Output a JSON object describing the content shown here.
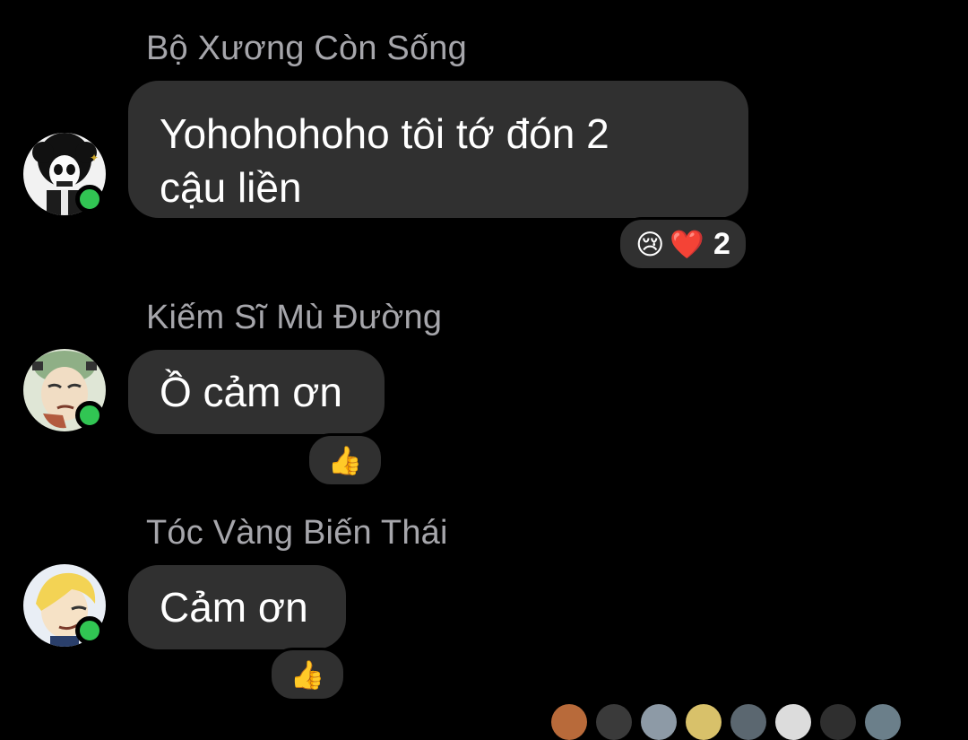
{
  "messages": [
    {
      "sender": "Bộ Xương Còn Sống",
      "text_line1": "Yohohohoho tôi tớ đón 2",
      "text_line2": "cậu liền",
      "reactions": [
        "😢",
        "❤️"
      ],
      "reaction_count": "2",
      "avatar": "brook-skeleton-avatar",
      "online": true
    },
    {
      "sender": "Kiếm Sĩ Mù Đường",
      "text_line1": "Ồ cảm ơn",
      "reactions": [
        "👍"
      ],
      "avatar": "zoro-swordsman-avatar",
      "online": true
    },
    {
      "sender": "Tóc Vàng Biến Thái",
      "text_line1": "Cảm ơn",
      "reactions": [
        "👍"
      ],
      "avatar": "sanji-blonde-avatar",
      "online": true
    }
  ],
  "colors": {
    "background": "#000000",
    "bubble": "#303030",
    "sender_name": "#a6a6ab",
    "online": "#31c553"
  }
}
